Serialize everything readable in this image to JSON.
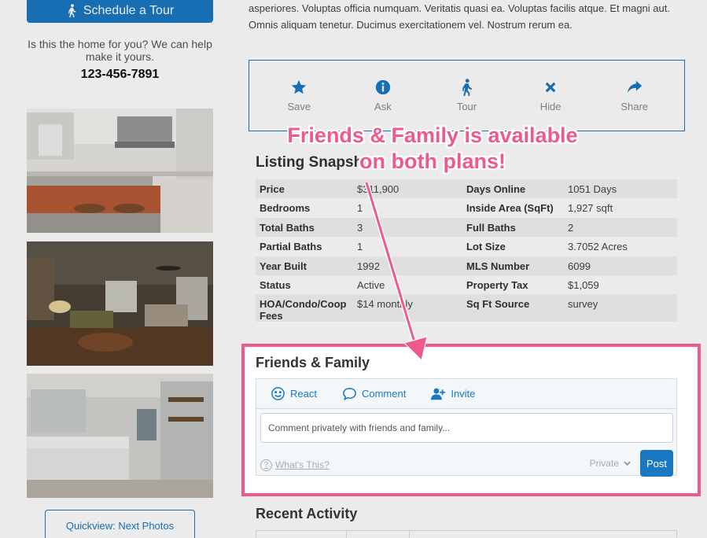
{
  "left": {
    "schedule_label": "Schedule a Tour",
    "help_text": "Is this the home for you? We can help make it yours.",
    "phone": "123-456-7891",
    "quickview_label": "Quickview: Next Photos"
  },
  "description": "asperiores. Voluptas officia numquam. Veritatis quasi ea. Voluptas facilis atque. Et magni aut. Omnis aliquam tenetur. Ducimus exercitationem vel. Nostrum rerum ea.",
  "actions": [
    {
      "label": "Save",
      "icon": "star-icon"
    },
    {
      "label": "Ask",
      "icon": "info-icon"
    },
    {
      "label": "Tour",
      "icon": "walking-icon"
    },
    {
      "label": "Hide",
      "icon": "close-icon"
    },
    {
      "label": "Share",
      "icon": "share-icon"
    }
  ],
  "snapshot": {
    "title": "Listing Snapshot",
    "rows": [
      {
        "l1": "Price",
        "v1": "$311,900",
        "l2": "Days Online",
        "v2": "1051 Days"
      },
      {
        "l1": "Bedrooms",
        "v1": "1",
        "l2": "Inside Area (SqFt)",
        "v2": "1,927 sqft"
      },
      {
        "l1": "Total Baths",
        "v1": "3",
        "l2": "Full Baths",
        "v2": "2"
      },
      {
        "l1": "Partial Baths",
        "v1": "1",
        "l2": "Lot Size",
        "v2": "3.7052 Acres"
      },
      {
        "l1": "Year Built",
        "v1": "1992",
        "l2": "MLS Number",
        "v2": "6099"
      },
      {
        "l1": "Status",
        "v1": "Active",
        "l2": "Property Tax",
        "v2": "$1,059"
      },
      {
        "l1": "HOA/Condo/Coop Fees",
        "v1": "$14 monthly",
        "l2": "Sq Ft Source",
        "v2": "survey"
      }
    ]
  },
  "friends_family": {
    "title": "Friends & Family",
    "tabs": {
      "react": "React",
      "comment": "Comment",
      "invite": "Invite"
    },
    "placeholder": "Comment privately with friends and family...",
    "whats_this": "What's This?",
    "privacy": "Private",
    "post_label": "Post"
  },
  "recent_activity_title": "Recent Activity",
  "annotation": {
    "line1": "Friends & Family is available",
    "line2": "on both plans!"
  },
  "colors": {
    "accent": "#1a78c2",
    "annotation": "#ee5a8c"
  }
}
